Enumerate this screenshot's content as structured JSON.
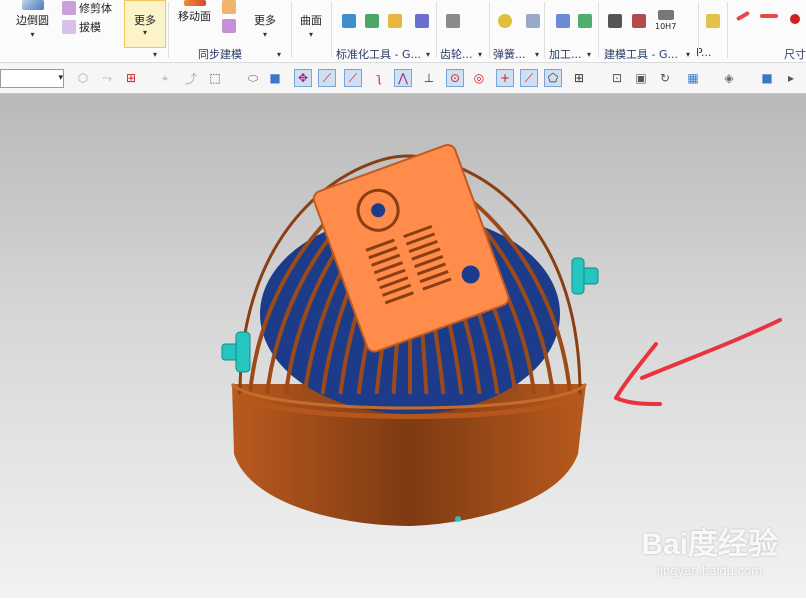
{
  "ribbon": {
    "buttons": {
      "edge_blend": "边倒圆",
      "trim_body": "修剪体",
      "draft": "拔模",
      "more_1": "更多",
      "move_face": "移动面",
      "more_2": "更多",
      "surface": "曲面",
      "dim_10h7": "10H7"
    },
    "groups": {
      "sync_modeling": "同步建模",
      "std_tools": "标准化工具 - G...",
      "gear": "齿轮...",
      "spring": "弹簧...",
      "machining": "加工...",
      "modeling_tools": "建模工具 - G...",
      "p": "P...",
      "dimension": "尺寸"
    }
  },
  "toolbar": {
    "selection_filter_value": ""
  },
  "viewport": {
    "model": "fan-cover-cage",
    "annotation_color": "#e8353d",
    "model_body_color": "#a14e19",
    "model_top_color": "#ff8c4b",
    "model_accent_color": "#1c3c8a",
    "connector_color": "#26c6c0"
  },
  "watermark": {
    "logo": "Bai度经验",
    "url": "jingyan.baidu.com"
  }
}
